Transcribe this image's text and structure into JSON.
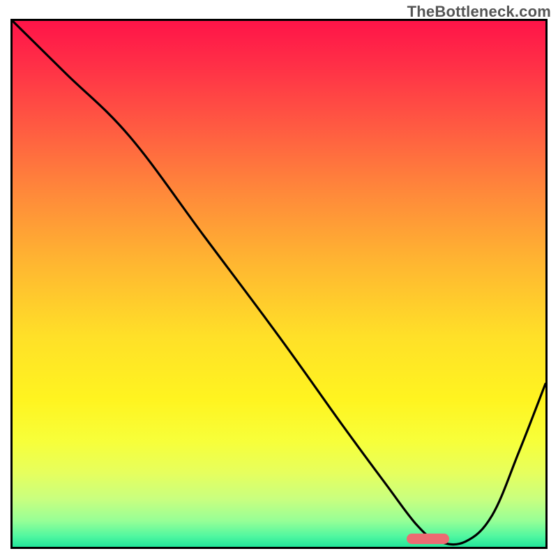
{
  "watermark": "TheBottleneck.com",
  "chart_data": {
    "type": "line",
    "title": "",
    "xlabel": "",
    "ylabel": "",
    "xlim": [
      0,
      100
    ],
    "ylim": [
      0,
      100
    ],
    "x": [
      0,
      10,
      22,
      36,
      50,
      62,
      70,
      76,
      80,
      85,
      90,
      95,
      100
    ],
    "y": [
      100,
      90,
      78,
      59,
      40,
      23,
      12,
      4,
      1,
      1,
      6,
      18,
      31
    ],
    "background": "vertical gradient red→yellow→green",
    "marker": {
      "x_center": 78,
      "width_pct": 8,
      "y": 1.5,
      "color": "#ec6b72"
    },
    "note": "x and y in percent of axis range; curve descends from top-left, dips near bottom around x≈78–85, then rises toward top-right"
  }
}
